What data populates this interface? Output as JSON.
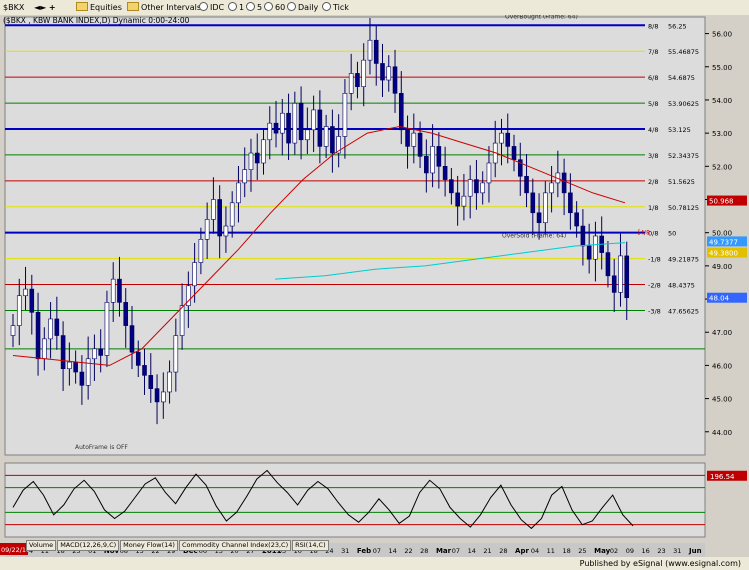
{
  "toolbar": {
    "symbol": "$BKX",
    "group": "Equities",
    "other": "Other Intervals",
    "source": "IDC",
    "intervals": [
      "1",
      "5",
      "60",
      "Daily",
      "Tick"
    ]
  },
  "title": "($BKX , KBW BANK INDEX,D) Dynamic 0:00-24:00",
  "footer": "Published by eSignal (www.esignal.com)",
  "study_tabs": [
    "Volume",
    "MACD(12,26,9,C)",
    "Money Flow(14)",
    "Commodity Channel Index(23,C)",
    "RSI(14,C)"
  ],
  "chart_data": {
    "type": "candlestick",
    "title": "($BKX , KBW BANK INDEX,D) Dynamic 0:00-24:00",
    "ylim": [
      43.3,
      56.5
    ],
    "y_ticks": [
      44.0,
      45.0,
      46.0,
      47.0,
      48.0,
      49.0,
      50.0,
      51.0,
      52.0,
      53.0,
      54.0,
      55.0,
      56.0
    ],
    "x_labels": [
      "Oct",
      "04",
      "11",
      "18",
      "25",
      "01",
      "Nov",
      "08",
      "15",
      "22",
      "29",
      "Dec",
      "06",
      "13",
      "20",
      "27",
      "2011",
      "03",
      "10",
      "18",
      "24",
      "31",
      "Feb",
      "07",
      "14",
      "22",
      "28",
      "Mar",
      "07",
      "14",
      "21",
      "28",
      "Apr",
      "04",
      "11",
      "18",
      "25",
      "May",
      "02",
      "09",
      "16",
      "23",
      "31",
      "Jun"
    ],
    "start_label": "09/22/10",
    "murrey_lines": [
      {
        "label": "8/8",
        "value": 56.25,
        "color": "#0000c0"
      },
      {
        "label": "7/8",
        "value": 55.46875,
        "color": "#e0e000"
      },
      {
        "label": "6/8",
        "value": 54.6875,
        "color": "#c00000"
      },
      {
        "label": "5/8",
        "value": 53.90625,
        "color": "#008000"
      },
      {
        "label": "4/8",
        "value": 53.125,
        "color": "#0000c0"
      },
      {
        "label": "3/8",
        "value": 52.34375,
        "color": "#008000"
      },
      {
        "label": "2/8",
        "value": 51.5625,
        "color": "#c00000"
      },
      {
        "label": "1/8",
        "value": 50.78125,
        "color": "#e0e000"
      },
      {
        "label": "0/8",
        "value": 50.0,
        "color": "#0000c0"
      },
      {
        "label": "-1/8",
        "value": 49.21875,
        "color": "#e0e000"
      },
      {
        "label": "-2/8",
        "value": 48.4375,
        "color": "#c00000"
      },
      {
        "label": "-3/8",
        "value": 47.65625,
        "color": "#008000"
      }
    ],
    "extra_lines": [
      {
        "value": 46.5,
        "color": "#008000"
      }
    ],
    "annotations": [
      "OverBought (Frame: 64)",
      "OverSold (Frame: 64)",
      "AutoFrame is OFF",
      "[4/8"
    ],
    "price_flags": [
      {
        "value": 50.968,
        "text": "50.968",
        "color": "#c00000"
      },
      {
        "value": 49.737,
        "text": "49.7377",
        "color": "#3399ff"
      },
      {
        "value": 49.4,
        "text": "49.3800",
        "color": "#e0c000"
      },
      {
        "value": 48.04,
        "text": "48.04",
        "color": "#3366ff"
      }
    ],
    "closes": [
      47.2,
      48.1,
      48.3,
      47.6,
      46.2,
      46.8,
      47.4,
      46.9,
      45.9,
      46.1,
      45.8,
      45.4,
      46.2,
      46.5,
      46.3,
      47.9,
      48.6,
      47.9,
      47.2,
      46.4,
      46.0,
      45.7,
      45.3,
      44.9,
      45.2,
      45.8,
      46.9,
      47.8,
      48.4,
      49.1,
      49.8,
      50.4,
      51.0,
      49.9,
      50.2,
      50.9,
      51.5,
      51.9,
      52.4,
      52.1,
      52.8,
      53.3,
      53.0,
      53.6,
      52.7,
      53.9,
      52.8,
      53.1,
      53.7,
      52.6,
      53.2,
      52.4,
      52.9,
      54.2,
      54.8,
      54.4,
      55.2,
      55.8,
      55.1,
      54.6,
      55.0,
      54.2,
      53.1,
      52.6,
      53.0,
      52.3,
      51.8,
      52.6,
      52.0,
      51.6,
      51.2,
      50.8,
      51.1,
      51.6,
      51.2,
      51.5,
      52.1,
      52.7,
      53.0,
      52.6,
      52.2,
      51.7,
      51.2,
      50.6,
      50.3,
      51.2,
      51.5,
      51.8,
      51.2,
      50.6,
      50.2,
      49.6,
      49.2,
      49.9,
      49.4,
      48.7,
      48.2,
      49.3,
      48.04
    ],
    "ma_slow": [
      46.3,
      46.2,
      46.1,
      46.0,
      46.5,
      47.5,
      48.5,
      49.5,
      50.6,
      51.6,
      52.4,
      53.0,
      53.2,
      53.0,
      52.7,
      52.4,
      52.0,
      51.6,
      51.2,
      50.9
    ],
    "ma_fast": [
      48.6,
      48.7,
      48.9,
      49.0,
      49.2,
      49.4,
      49.6,
      49.7
    ],
    "lower_panel": {
      "type": "line",
      "ylim": [
        -300,
        300
      ],
      "levels": [
        200,
        100,
        -100,
        -200
      ],
      "last_value_text": "196.54",
      "values": [
        -60,
        80,
        150,
        40,
        -120,
        -40,
        90,
        160,
        70,
        -80,
        -150,
        -90,
        20,
        130,
        180,
        60,
        -30,
        100,
        210,
        120,
        -50,
        -170,
        -100,
        30,
        170,
        240,
        140,
        60,
        -40,
        80,
        150,
        90,
        -20,
        -120,
        -180,
        -100,
        10,
        -80,
        -190,
        -130,
        60,
        160,
        90,
        -60,
        -150,
        -220,
        -120,
        20,
        120,
        -40,
        -160,
        -230,
        -150,
        40,
        110,
        -80,
        -200,
        -170,
        -60,
        40,
        -120,
        -210
      ]
    }
  }
}
